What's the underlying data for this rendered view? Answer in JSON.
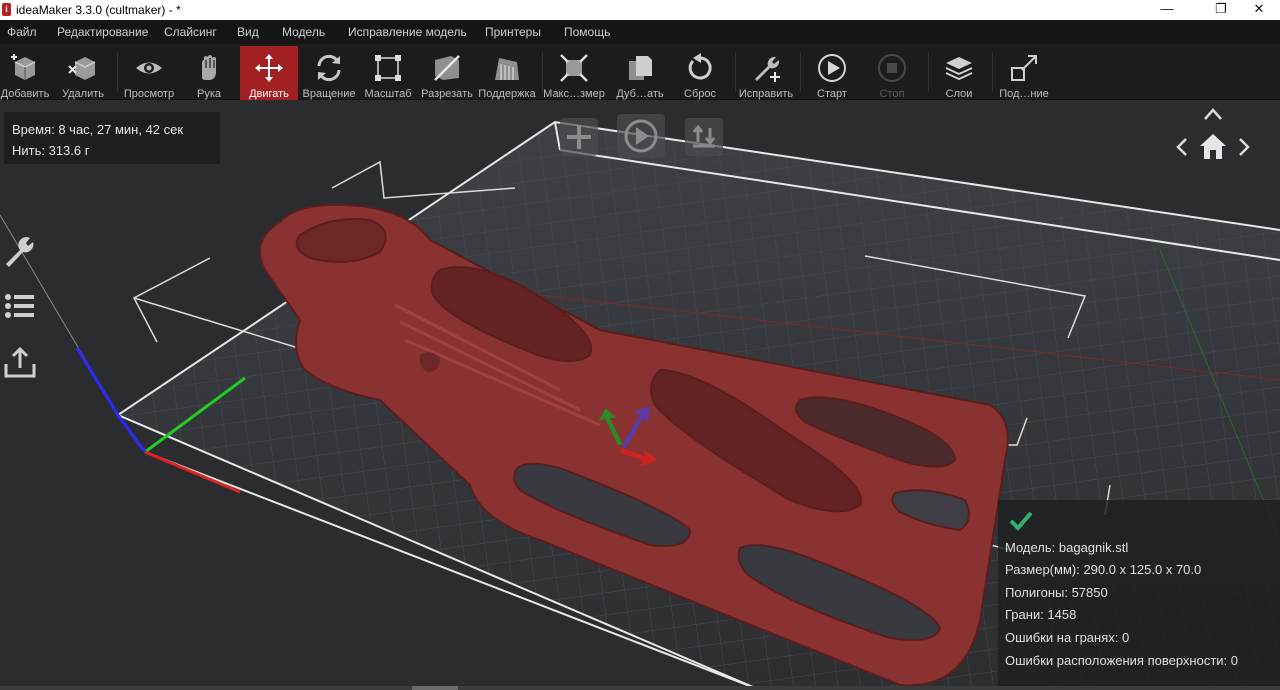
{
  "window": {
    "title": "ideaMaker 3.3.0 (cultmaker) - *",
    "logo_letter": "i",
    "minimize": "—",
    "maximize": "❐",
    "close": "✕"
  },
  "menu": [
    "Файл",
    "Редактирование",
    "Слайсинг",
    "Вид",
    "Модель",
    "Исправление модель",
    "Принтеры",
    "Помощь"
  ],
  "toolbar": {
    "add": "Добавить",
    "delete": "Удалить",
    "preview": "Просмотр",
    "hand": "Рука",
    "move": "Двигать",
    "rotate": "Вращение",
    "scale": "Масштаб",
    "cut": "Разрезать",
    "support": "Поддержка",
    "maximize": "Макс…змер",
    "duplicate": "Дуб…ать",
    "reset": "Сброс",
    "repair": "Исправить",
    "start": "Старт",
    "stop": "Стоп",
    "layers": "Слои",
    "sub": "Под…ние"
  },
  "stats": {
    "time": "Время: 8 час, 27 мин, 42 сек",
    "filament": "Нить: 313.6 г"
  },
  "model_info": {
    "status_icon": "check-icon",
    "model": "Модель: bagagnik.stl",
    "size": "Размер(мм): 290.0 x 125.0 x 70.0",
    "polygons": "Полигоны: 57850",
    "edges": "Грани: 1458",
    "edge_errors": "Ошибки на гранях: 0",
    "surface_errors": "Ошибки расположения поверхности: 0"
  },
  "colors": {
    "accent": "#a21f22",
    "model": "#8a3232",
    "toolbar_bg": "#1c1c1c",
    "menu_bg": "#151515",
    "viewport_bg": "#2a2c2f",
    "check": "#2fb36a"
  }
}
